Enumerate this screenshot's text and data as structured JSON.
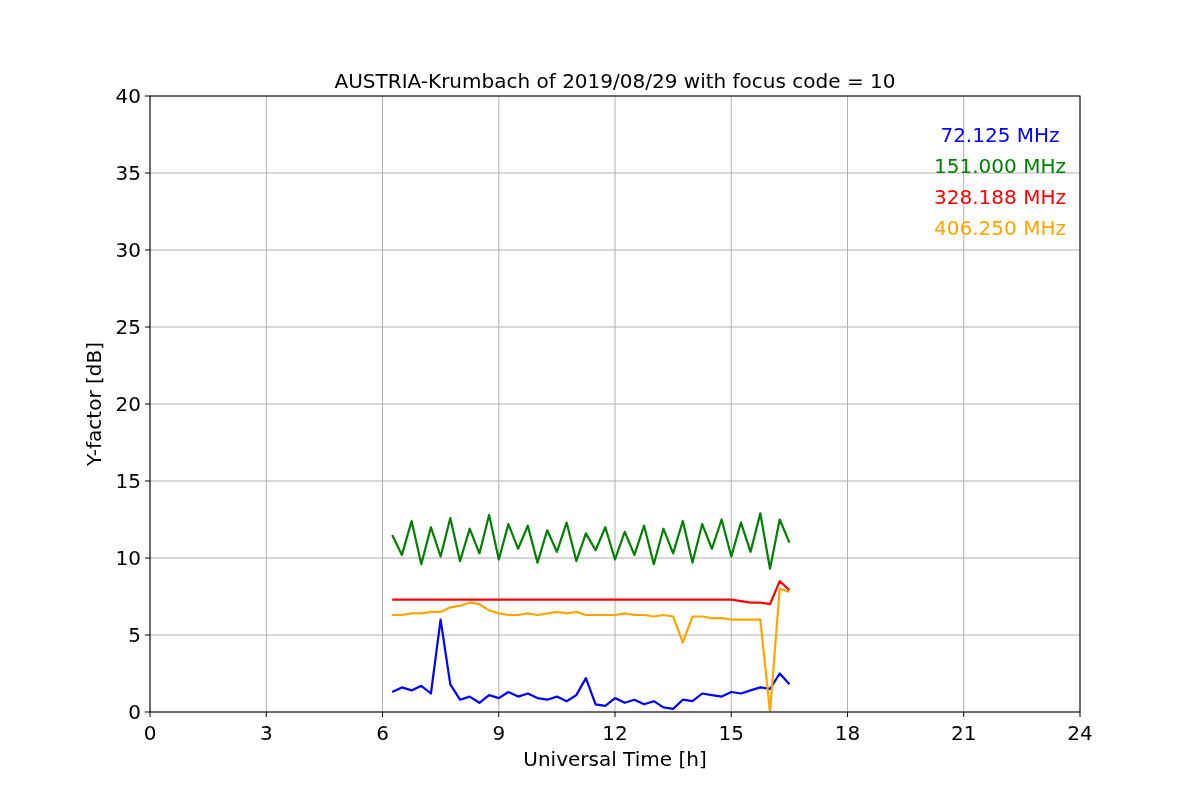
{
  "chart_data": {
    "type": "line",
    "title": "AUSTRIA-Krumbach of 2019/08/29 with focus code = 10",
    "xlabel": "Universal Time [h]",
    "ylabel": "Y-factor [dB]",
    "grid": true,
    "xlim": [
      0,
      24
    ],
    "ylim": [
      0,
      40
    ],
    "xticks": [
      0,
      3,
      6,
      9,
      12,
      15,
      18,
      21,
      24
    ],
    "yticks": [
      0,
      5,
      10,
      15,
      20,
      25,
      30,
      35,
      40
    ],
    "x": [
      6.25,
      6.5,
      6.75,
      7.0,
      7.25,
      7.5,
      7.75,
      8.0,
      8.25,
      8.5,
      8.75,
      9.0,
      9.25,
      9.5,
      9.75,
      10.0,
      10.25,
      10.5,
      10.75,
      11.0,
      11.25,
      11.5,
      11.75,
      12.0,
      12.25,
      12.5,
      12.75,
      13.0,
      13.25,
      13.5,
      13.75,
      14.0,
      14.25,
      14.5,
      14.75,
      15.0,
      15.25,
      15.5,
      15.75,
      16.0,
      16.25,
      16.5
    ],
    "series": [
      {
        "name": "72.125 MHz",
        "color": "#0000ff",
        "values": [
          1.3,
          1.6,
          1.4,
          1.7,
          1.2,
          6.0,
          1.8,
          0.8,
          1.0,
          0.6,
          1.1,
          0.9,
          1.3,
          1.0,
          1.2,
          0.9,
          0.8,
          1.0,
          0.7,
          1.1,
          2.2,
          0.5,
          0.4,
          0.9,
          0.6,
          0.8,
          0.5,
          0.7,
          0.3,
          0.2,
          0.8,
          0.7,
          1.2,
          1.1,
          1.0,
          1.3,
          1.2,
          1.4,
          1.6,
          1.5,
          2.5,
          1.8
        ]
      },
      {
        "name": "151.000 MHz",
        "color": "#008000",
        "values": [
          11.5,
          10.2,
          12.4,
          9.6,
          12.0,
          10.1,
          12.6,
          9.8,
          11.9,
          10.3,
          12.8,
          9.9,
          12.2,
          10.6,
          12.1,
          9.7,
          11.8,
          10.4,
          12.3,
          9.8,
          11.6,
          10.5,
          12.0,
          9.9,
          11.7,
          10.2,
          12.1,
          9.6,
          11.9,
          10.3,
          12.4,
          9.7,
          12.2,
          10.6,
          12.5,
          10.1,
          12.3,
          10.4,
          12.9,
          9.3,
          12.5,
          11.0
        ]
      },
      {
        "name": "328.188 MHz",
        "color": "#ff0000",
        "values": [
          7.3,
          7.3,
          7.3,
          7.3,
          7.3,
          7.3,
          7.3,
          7.3,
          7.3,
          7.3,
          7.3,
          7.3,
          7.3,
          7.3,
          7.3,
          7.3,
          7.3,
          7.3,
          7.3,
          7.3,
          7.3,
          7.3,
          7.3,
          7.3,
          7.3,
          7.3,
          7.3,
          7.3,
          7.3,
          7.3,
          7.3,
          7.3,
          7.3,
          7.3,
          7.3,
          7.3,
          7.2,
          7.1,
          7.1,
          7.0,
          8.5,
          7.9
        ]
      },
      {
        "name": "406.250 MHz",
        "color": "#ffa500",
        "values": [
          6.3,
          6.3,
          6.4,
          6.4,
          6.5,
          6.5,
          6.8,
          6.9,
          7.1,
          7.0,
          6.6,
          6.4,
          6.3,
          6.3,
          6.4,
          6.3,
          6.4,
          6.5,
          6.4,
          6.5,
          6.3,
          6.3,
          6.3,
          6.3,
          6.4,
          6.3,
          6.3,
          6.2,
          6.3,
          6.2,
          4.5,
          6.2,
          6.2,
          6.1,
          6.1,
          6.0,
          6.0,
          6.0,
          6.0,
          0.0,
          8.0,
          7.8
        ]
      }
    ]
  }
}
